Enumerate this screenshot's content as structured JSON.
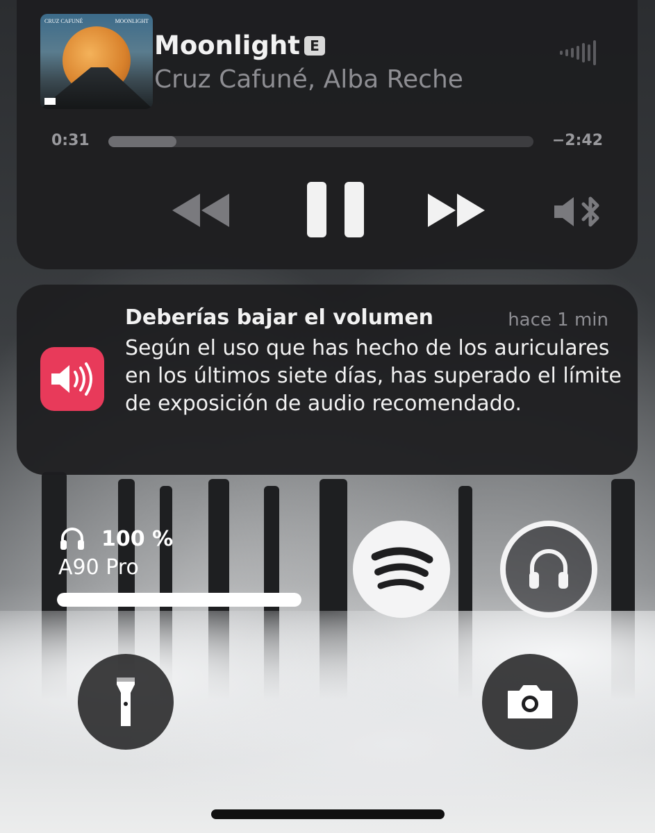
{
  "now_playing": {
    "title": "Moonlight",
    "explicit_badge": "E",
    "artist": "Cruz Cafuné, Alba Reche",
    "artwork_text_left": "CRUZ CAFUNÉ",
    "artwork_text_right": "MOONLIGHT",
    "elapsed": "0:31",
    "remaining": "−2:42",
    "progress_fraction": 0.16,
    "controls": [
      "rewind-icon",
      "pause-icon",
      "fast-forward-icon",
      "bluetooth-audio-route-icon"
    ],
    "waveform_icon": "audio-waveform-icon"
  },
  "notification": {
    "icon": "speaker-volume-icon",
    "title": "Deberías bajar el volumen",
    "time": "hace 1 min",
    "body": "Según el uso que has hecho de los auriculares en los últimos siete días, has superado el límite de exposición de audio recomendado."
  },
  "device": {
    "icon": "headphones-icon",
    "battery": "100 %",
    "name": "A90 Pro",
    "battery_fraction": 1.0
  },
  "widgets": {
    "spotify_icon": "spotify-icon",
    "headphones_icon": "headphones-icon"
  },
  "shortcuts": {
    "left": "flashlight-icon",
    "right": "camera-icon"
  },
  "colors": {
    "accent_notification": "#e83a5a",
    "card_background": "#1e1e20"
  }
}
